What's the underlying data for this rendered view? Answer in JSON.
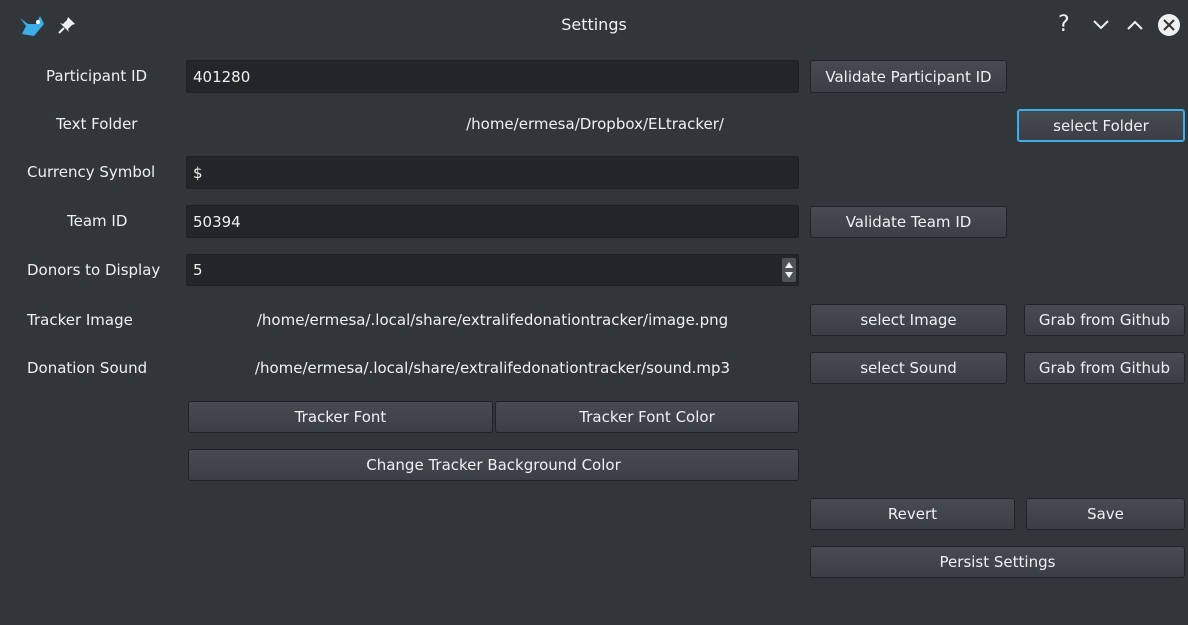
{
  "window": {
    "title": "Settings"
  },
  "titlebar_icons": {
    "app": "eye-icon",
    "pin": "pin-icon",
    "help": "?",
    "minimize": "chevron-down-icon",
    "maximize": "chevron-up-icon",
    "close": "close-icon"
  },
  "participant": {
    "label": "Participant ID",
    "value": "401280",
    "validate_label": "Validate Participant ID"
  },
  "text_folder": {
    "label": "Text Folder",
    "path": "/home/ermesa/Dropbox/ELtracker/",
    "button": "select Folder"
  },
  "currency": {
    "label": "Currency Symbol",
    "value": "$"
  },
  "team": {
    "label": "Team ID",
    "value": "50394",
    "validate_label": "Validate Team ID"
  },
  "donors": {
    "label": "Donors to Display",
    "value": "5"
  },
  "tracker_image": {
    "label": "Tracker Image",
    "path": "/home/ermesa/.local/share/extralifedonationtracker/image.png",
    "select": "select Image",
    "grab": "Grab from Github"
  },
  "donation_sound": {
    "label": "Donation Sound",
    "path": "/home/ermesa/.local/share/extralifedonationtracker/sound.mp3",
    "select": "select Sound",
    "grab": "Grab from Github"
  },
  "font": {
    "tracker_font": "Tracker Font",
    "tracker_font_color": "Tracker Font Color",
    "background": "Change Tracker Background Color"
  },
  "actions": {
    "revert": "Revert",
    "save": "Save",
    "persist": "Persist Settings"
  },
  "colors": {
    "bg": "#31363b",
    "field": "#232629",
    "accent": "#3daee9"
  }
}
